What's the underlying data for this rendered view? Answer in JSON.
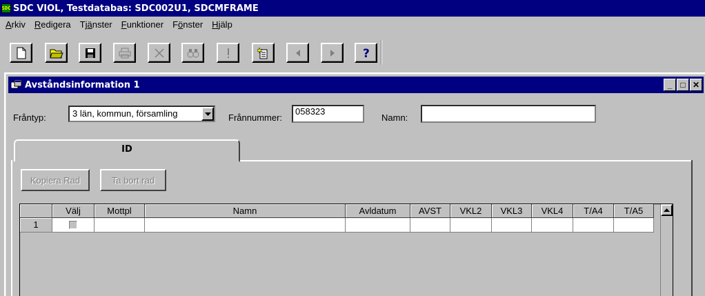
{
  "app": {
    "logo_text": "SDC",
    "title": "SDC VIOL, Testdatabas: SDC002U1, SDCMFRAME"
  },
  "menu": [
    {
      "mnemonic": "A",
      "rest": "rkiv"
    },
    {
      "mnemonic": "R",
      "rest": "edigera"
    },
    {
      "pre": "Tj",
      "mnemonic": "ä",
      "rest": "nster"
    },
    {
      "mnemonic": "F",
      "rest": "unktioner"
    },
    {
      "pre": "F",
      "mnemonic": "ö",
      "rest": "nster"
    },
    {
      "mnemonic": "H",
      "rest": "jälp"
    }
  ],
  "toolbar": {
    "icons": [
      "new-document-icon",
      "open-folder-icon",
      "save-disk-icon",
      "print-icon",
      "delete-x-icon",
      "find-binoculars-icon",
      "exclamation-icon",
      "new-item-icon",
      "previous-arrow-icon",
      "next-arrow-icon",
      "help-question-icon"
    ]
  },
  "child_window": {
    "title": "Avståndsinformation 1",
    "controls": {
      "minimize": "_",
      "maximize": "□",
      "close": "✕"
    }
  },
  "form": {
    "frantyp_label": "Fråntyp:",
    "frantyp_value": "3 län, kommun, församling",
    "frannummer_label": "Frånnummer:",
    "frannummer_value": "058323",
    "namn_label": "Namn:",
    "namn_value": ""
  },
  "tabs": [
    {
      "label": "ID",
      "active": true
    }
  ],
  "buttons": {
    "kopiera_rad": "Kopiera Rad",
    "ta_bort_rad": "Ta bort rad"
  },
  "grid": {
    "columns": [
      "",
      "Välj",
      "Mottpl",
      "Namn",
      "Avldatum",
      "AVST",
      "VKL2",
      "VKL3",
      "VKL4",
      "T/A4",
      "T/A5"
    ],
    "rows": [
      {
        "num": "1",
        "valj": false,
        "mottpl": "",
        "namn": "",
        "avldatum": "",
        "avst": "",
        "vkl2": "",
        "vkl3": "",
        "vkl4": "",
        "ta4": "",
        "ta5": ""
      }
    ]
  }
}
